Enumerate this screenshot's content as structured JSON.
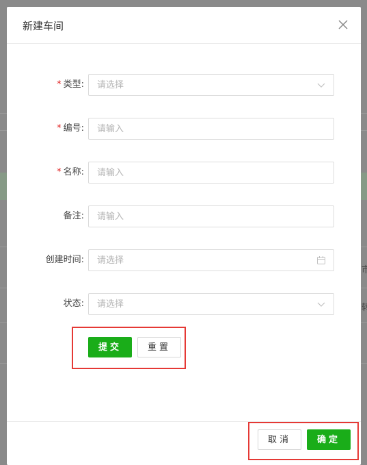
{
  "dialog": {
    "title": "新建车间",
    "close_icon": "close-icon"
  },
  "form": {
    "fields": [
      {
        "label": "类型",
        "required": true,
        "placeholder": "请选择",
        "type": "select"
      },
      {
        "label": "编号",
        "required": true,
        "placeholder": "请输入",
        "type": "text"
      },
      {
        "label": "名称",
        "required": true,
        "placeholder": "请输入",
        "type": "text"
      },
      {
        "label": "备注",
        "required": false,
        "placeholder": "请输入",
        "type": "text"
      },
      {
        "label": "创建时间",
        "required": false,
        "placeholder": "请选择",
        "type": "date"
      },
      {
        "label": "状态",
        "required": false,
        "placeholder": "请选择",
        "type": "select"
      }
    ],
    "label_suffix": ":",
    "required_mark": "*",
    "submit_label": "提交",
    "reset_label": "重置"
  },
  "footer": {
    "cancel_label": "取消",
    "confirm_label": "确定"
  },
  "background": {
    "frag_1": "市",
    "frag_2": "转"
  },
  "colors": {
    "primary": "#1aad19",
    "required": "#e02020",
    "highlight": "#e53935",
    "overlay": "#7f7f7f"
  }
}
